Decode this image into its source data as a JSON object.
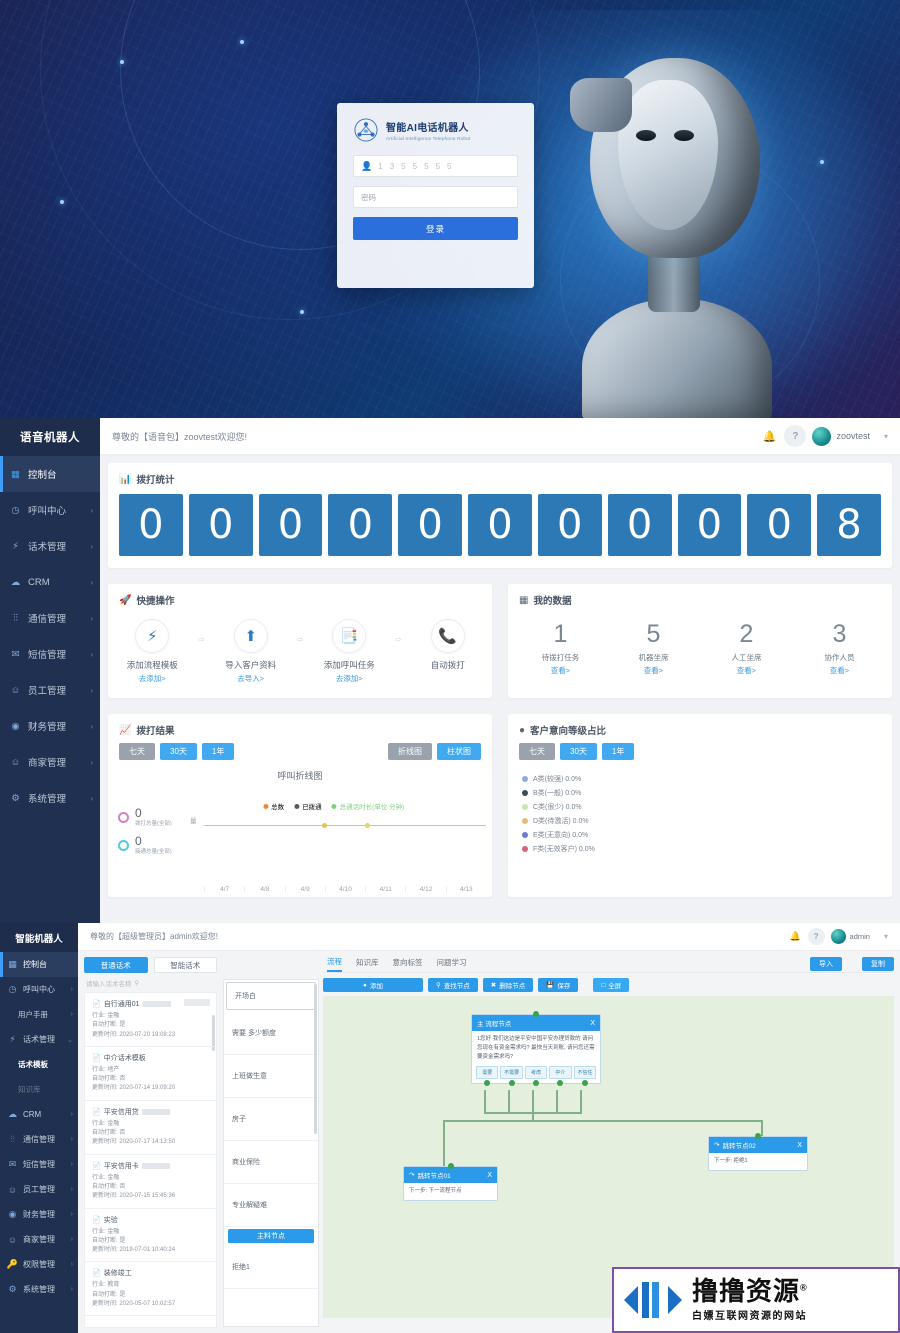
{
  "login": {
    "title": "智能AI电话机器人",
    "subtitle": "Artificial Intelligence Telephone Robot",
    "username_value": "1 3 5 5 5 5 5",
    "user_icon": "user-icon",
    "password_placeholder": "密码",
    "submit_label": "登录"
  },
  "dashboard": {
    "sidebar": {
      "title": "语音机器人",
      "items": [
        {
          "label": "控制台",
          "icon": "grid-icon",
          "arrow": "",
          "active": true
        },
        {
          "label": "呼叫中心",
          "icon": "clock-icon",
          "arrow": "›"
        },
        {
          "label": "话术管理",
          "icon": "bolt-icon",
          "arrow": "›"
        },
        {
          "label": "CRM",
          "icon": "cloud-icon",
          "arrow": "›"
        },
        {
          "label": "通信管理",
          "icon": "sliders-icon",
          "arrow": "›"
        },
        {
          "label": "短信管理",
          "icon": "mail-icon",
          "arrow": "›"
        },
        {
          "label": "员工管理",
          "icon": "user-icon",
          "arrow": "›"
        },
        {
          "label": "财务管理",
          "icon": "shield-icon",
          "arrow": "›"
        },
        {
          "label": "商家管理",
          "icon": "person-icon",
          "arrow": "›"
        },
        {
          "label": "系统管理",
          "icon": "gear-icon",
          "arrow": "›"
        }
      ]
    },
    "topbar": {
      "welcome": "尊敬的【语音包】zoovtest欢迎您!",
      "bell_icon": "bell-icon",
      "help_icon": "help-icon",
      "avatar": "avatar",
      "username": "zoovtest",
      "caret": "▾"
    },
    "stats_card": {
      "icon": "bar-chart-icon",
      "title": "拨打统计",
      "digits": [
        "0",
        "0",
        "0",
        "0",
        "0",
        "0",
        "0",
        "0",
        "0",
        "0",
        "8"
      ]
    },
    "quick": {
      "icon": "rocket-icon",
      "title": "快捷操作",
      "arrow": "⇨",
      "actions": [
        {
          "icon": "bolt-icon",
          "title": "添加流程模板",
          "link": "去添加>"
        },
        {
          "icon": "upload-icon",
          "title": "导入客户资料",
          "link": "去导入>"
        },
        {
          "icon": "file-icon",
          "title": "添加呼叫任务",
          "link": "去添加>"
        },
        {
          "icon": "phone-icon",
          "title": "自动拨打",
          "link": ""
        }
      ]
    },
    "mydata": {
      "icon": "table-icon",
      "title": "我的数据",
      "items": [
        {
          "value": "1",
          "title": "待拨打任务",
          "link": "查看>"
        },
        {
          "value": "5",
          "title": "机器坐席",
          "link": "查看>"
        },
        {
          "value": "2",
          "title": "人工坐席",
          "link": "查看>"
        },
        {
          "value": "3",
          "title": "协作人员",
          "link": "查看>"
        }
      ]
    },
    "result": {
      "icon": "line-chart-icon",
      "title": "拨打结果",
      "range_buttons": [
        {
          "label": "七天",
          "active": false
        },
        {
          "label": "30天",
          "active": true
        },
        {
          "label": "1年",
          "active": true
        }
      ],
      "type_buttons": [
        {
          "label": "折线图",
          "active": false
        },
        {
          "label": "柱状图",
          "active": true
        }
      ],
      "side_stats": [
        {
          "value": "0",
          "caption": "拨打总量(全部)",
          "color": "#d083c8"
        },
        {
          "value": "0",
          "caption": "接通总量(全部)",
          "color": "#4ccfe0"
        }
      ]
    },
    "intent": {
      "icon": "pie-icon",
      "title": "客户意向等级占比",
      "range_buttons": [
        {
          "label": "七天",
          "active": false
        },
        {
          "label": "30天",
          "active": true
        },
        {
          "label": "1年",
          "active": true
        }
      ]
    }
  },
  "chart_data": [
    {
      "type": "line",
      "title": "呼叫折线图",
      "x": [
        "4/7",
        "4/8",
        "4/9",
        "4/10",
        "4/11",
        "4/12",
        "4/13"
      ],
      "series": [
        {
          "name": "已拨通",
          "values": [
            0,
            0,
            0,
            0,
            0,
            0,
            0
          ],
          "color": "#e8c15a"
        },
        {
          "name": "总数",
          "values": [
            0,
            0,
            0,
            0,
            0,
            0,
            0
          ],
          "color": "#e88a3c"
        },
        {
          "name": "总通话时长(单位:分钟)",
          "values": [
            0,
            0,
            0,
            0,
            0,
            0,
            0
          ],
          "color": "#7fd17f"
        }
      ],
      "xlabel": "",
      "ylabel": "量",
      "ylim": [
        0,
        1
      ],
      "grid": true,
      "legend_position": "top"
    },
    {
      "type": "pie",
      "title": "客户意向等级占比",
      "categories": [
        "A类(较强)",
        "B类(一般)",
        "C类(很少)",
        "D类(待激活)",
        "E类(无意向)",
        "F类(无效客户)"
      ],
      "values": [
        0.0,
        0.0,
        0.0,
        0.0,
        0.0,
        0.0
      ],
      "labels": [
        "A类(较强) 0.0%",
        "B类(一般) 0.0%",
        "C类(很少) 0.0%",
        "D类(待激活) 0.0%",
        "E类(无意向) 0.0%",
        "F类(无效客户) 0.0%"
      ],
      "colors": [
        "#8fa9dd",
        "#3c4a5a",
        "#c7e6ae",
        "#e0bd7b",
        "#6d7ad4",
        "#d4647e"
      ],
      "legend_position": "left"
    }
  ],
  "flow": {
    "sidebar": {
      "title": "智能机器人",
      "items": [
        {
          "label": "控制台",
          "icon": "grid-icon",
          "arrow": "",
          "active": true
        },
        {
          "label": "呼叫中心",
          "icon": "clock-icon",
          "arrow": "›"
        },
        {
          "label": "用户手册",
          "icon": "",
          "arrow": "›",
          "sub": true
        },
        {
          "label": "话术管理",
          "icon": "bolt-icon",
          "arrow": "⌄"
        },
        {
          "label": "话术模板",
          "icon": "",
          "arrow": "",
          "sub": true,
          "subactive": true
        },
        {
          "label": "知识库",
          "icon": "",
          "arrow": "",
          "sub": true,
          "dim": true
        },
        {
          "label": "CRM",
          "icon": "cloud-icon",
          "arrow": "›"
        },
        {
          "label": "通信管理",
          "icon": "sliders-icon",
          "arrow": "›"
        },
        {
          "label": "短信管理",
          "icon": "mail-icon",
          "arrow": "›"
        },
        {
          "label": "员工管理",
          "icon": "user-icon",
          "arrow": "›"
        },
        {
          "label": "财务管理",
          "icon": "shield-icon",
          "arrow": "›"
        },
        {
          "label": "商家管理",
          "icon": "person-icon",
          "arrow": "›"
        },
        {
          "label": "权限管理",
          "icon": "key-icon",
          "arrow": "›",
          "active2": true
        },
        {
          "label": "系统管理",
          "icon": "gear-icon",
          "arrow": "›"
        }
      ]
    },
    "topbar": {
      "welcome": "尊敬的【超级管理员】admin欢迎您!",
      "bell_icon": "bell-icon",
      "help_icon": "help-icon",
      "avatar": "avatar",
      "username": "admin",
      "caret": "▾"
    },
    "list": {
      "tabs": [
        {
          "label": "普通话术",
          "active": true
        },
        {
          "label": "智能话术",
          "active": false
        }
      ],
      "search_placeholder": "请输入话术名称",
      "search_icon": "search-icon",
      "items": [
        {
          "name": "自行通用01",
          "industry": "行业: 金融",
          "interrupt": "自动打断: 是",
          "updated": "更新时间: 2020-07-20 19:08:23"
        },
        {
          "name": "中介话术模板",
          "industry": "行业: 地产",
          "interrupt": "自动打断: 否",
          "updated": "更新时间: 2020-07-14 19:09:20"
        },
        {
          "name": "平安信用贷",
          "industry": "行业: 金融",
          "interrupt": "自动打断: 否",
          "updated": "更新时间: 2020-07-17 14:13:50"
        },
        {
          "name": "平安信用卡",
          "industry": "行业: 金融",
          "interrupt": "自动打断: 否",
          "updated": "更新时间: 2020-07-15 15:45:36"
        },
        {
          "name": "实验",
          "industry": "行业: 金融",
          "interrupt": "自动打断: 是",
          "updated": "更新时间: 2019-07-01 10:40:24"
        },
        {
          "name": "装修竣工",
          "industry": "行业: 教育",
          "interrupt": "自动打断: 是",
          "updated": "更新时间: 2020-05-07 10:02:57"
        }
      ]
    },
    "nodes_list": [
      {
        "label": "开场白",
        "active": false,
        "first": true
      },
      {
        "label": "需要 多少额度",
        "active": false
      },
      {
        "label": "上班做生意",
        "active": false
      },
      {
        "label": "房子",
        "active": false
      },
      {
        "label": "商业保险",
        "active": false
      },
      {
        "label": "专业解疑难",
        "active": false
      },
      {
        "label": "主料节点",
        "active": true
      },
      {
        "label": "拒绝1",
        "active": false
      }
    ],
    "tabs": [
      {
        "label": "流程",
        "active": true
      },
      {
        "label": "知识库",
        "active": false
      },
      {
        "label": "意向标签",
        "active": false
      },
      {
        "label": "问题学习",
        "active": false
      }
    ],
    "header_buttons": [
      {
        "label": "导入"
      },
      {
        "label": "复制"
      }
    ],
    "toolbar": [
      {
        "label": "添加",
        "icon": "plus-icon",
        "wide": true
      },
      {
        "label": "查找节点",
        "icon": "search-icon"
      },
      {
        "label": "删除节点",
        "icon": "trash-icon"
      },
      {
        "label": "保存",
        "icon": "save-icon"
      },
      {
        "label": "全屏",
        "icon": "expand-icon"
      }
    ],
    "canvas_nodes": [
      {
        "id": "main",
        "title": "主 流程节点",
        "close": "X",
        "body": "1您好 我们这边是平安中国平安办理贷款的 请问您现在有资金需求吗? 最快当天到账, 请问您还需要资金需求吗?",
        "options": [
          "需要",
          "不需要",
          "考虑",
          "中介",
          "不信任"
        ]
      },
      {
        "id": "jump01",
        "title": "跳转节点01",
        "close": "X",
        "body": "下一步: 下一流程节点"
      },
      {
        "id": "jump02",
        "title": "跳转节点02",
        "close": "X",
        "body": "下一步: 拒绝1"
      }
    ]
  },
  "watermark": {
    "text": "撸撸资源",
    "reg": "®",
    "subtitle": "白嫖互联网资源的网站",
    "logo_icon": "brand-logo-icon"
  }
}
